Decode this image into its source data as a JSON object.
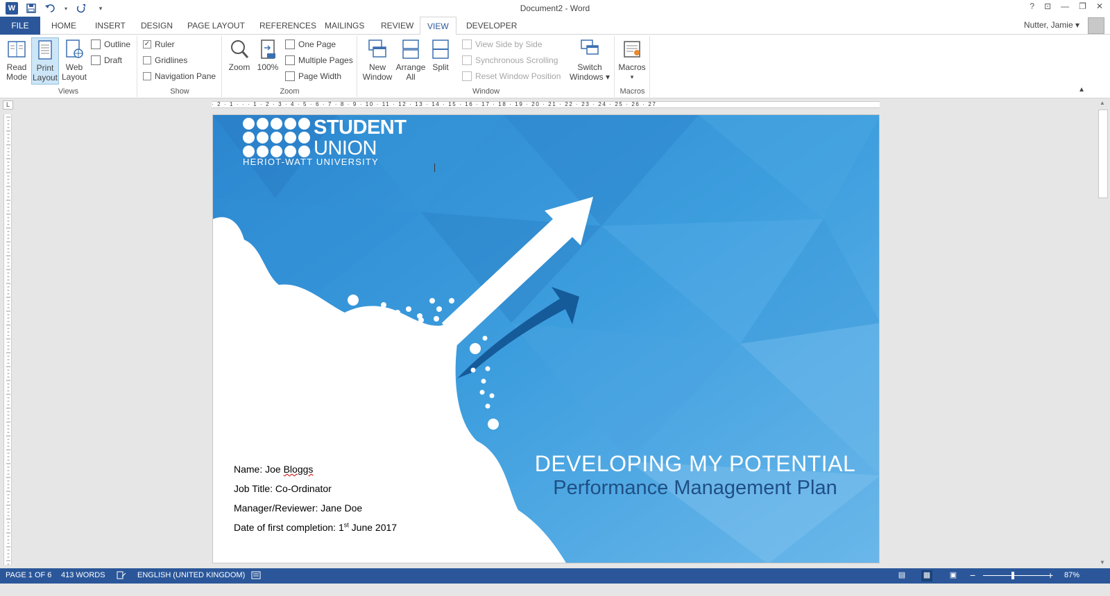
{
  "window": {
    "title": "Document2 - Word",
    "help": "?",
    "controls": [
      "⊡",
      "—",
      "❐",
      "✕"
    ]
  },
  "qat": {
    "app_icon": "W",
    "save_icon": "save-icon",
    "undo_icon": "undo-icon",
    "redo_icon": "redo-icon"
  },
  "tabs": [
    {
      "label": "FILE"
    },
    {
      "label": "HOME"
    },
    {
      "label": "INSERT"
    },
    {
      "label": "DESIGN"
    },
    {
      "label": "PAGE LAYOUT"
    },
    {
      "label": "REFERENCES"
    },
    {
      "label": "MAILINGS"
    },
    {
      "label": "REVIEW"
    },
    {
      "label": "VIEW"
    },
    {
      "label": "DEVELOPER"
    }
  ],
  "active_tab": "VIEW",
  "user": {
    "name": "Nutter, Jamie",
    "caret": "▾"
  },
  "ribbon": {
    "views": {
      "label": "Views",
      "read_mode": "Read Mode",
      "print_layout": "Print Layout",
      "web_layout": "Web Layout",
      "outline": "Outline",
      "draft": "Draft"
    },
    "show": {
      "label": "Show",
      "ruler": "Ruler",
      "ruler_checked": true,
      "gridlines": "Gridlines",
      "navigation_pane": "Navigation Pane"
    },
    "zoom": {
      "label": "Zoom",
      "zoom": "Zoom",
      "hundred": "100%",
      "one_page": "One Page",
      "multiple_pages": "Multiple Pages",
      "page_width": "Page Width"
    },
    "window": {
      "label": "Window",
      "new_window": "New Window",
      "arrange_all": "Arrange All",
      "split": "Split",
      "view_side_by_side": "View Side by Side",
      "sync_scrolling": "Synchronous Scrolling",
      "reset_position": "Reset Window Position",
      "switch_windows": "Switch Windows ▾"
    },
    "macros": {
      "label": "Macros",
      "macros": "Macros",
      "caret": "▾"
    }
  },
  "ruler": {
    "corner": "L",
    "ticks": "· 2 · 1 ·   ·   · 1 · 2 · 3 · 4 · 5 · 6 · 7 · 8 · 9 · 10 · 11 · 12 · 13 · 14 · 15 · 16 · 17 · 18 · 19 · 20 · 21 · 22 · 23 · 24 · 25 · 26 · 27"
  },
  "document": {
    "logo": {
      "line1": "STUDENT",
      "line2": "UNION",
      "line3": "HERIOT-WATT UNIVERSITY"
    },
    "headline": "DEVELOPING MY POTENTIAL",
    "subline": "Performance Management Plan",
    "fields": {
      "name_prefix": "Name: Joe ",
      "name_value": "Bloggs",
      "job_title": "Job Title: Co-Ordinator",
      "manager": "Manager/Reviewer: Jane Doe",
      "date_prefix": "Date of first completion: 1",
      "date_sup": "st",
      "date_suffix": " June 2017"
    },
    "colors": {
      "sky": "#2e8fd6",
      "sky_light": "#5aaee6",
      "arrow_dark": "#155a99",
      "subline": "#1f4f85"
    }
  },
  "status": {
    "page": "PAGE 1 OF 6",
    "words": "413 WORDS",
    "language": "ENGLISH (UNITED KINGDOM)",
    "zoom_minus": "−",
    "zoom_plus": "+",
    "zoom": "87%",
    "zoom_level_percent": 87
  }
}
